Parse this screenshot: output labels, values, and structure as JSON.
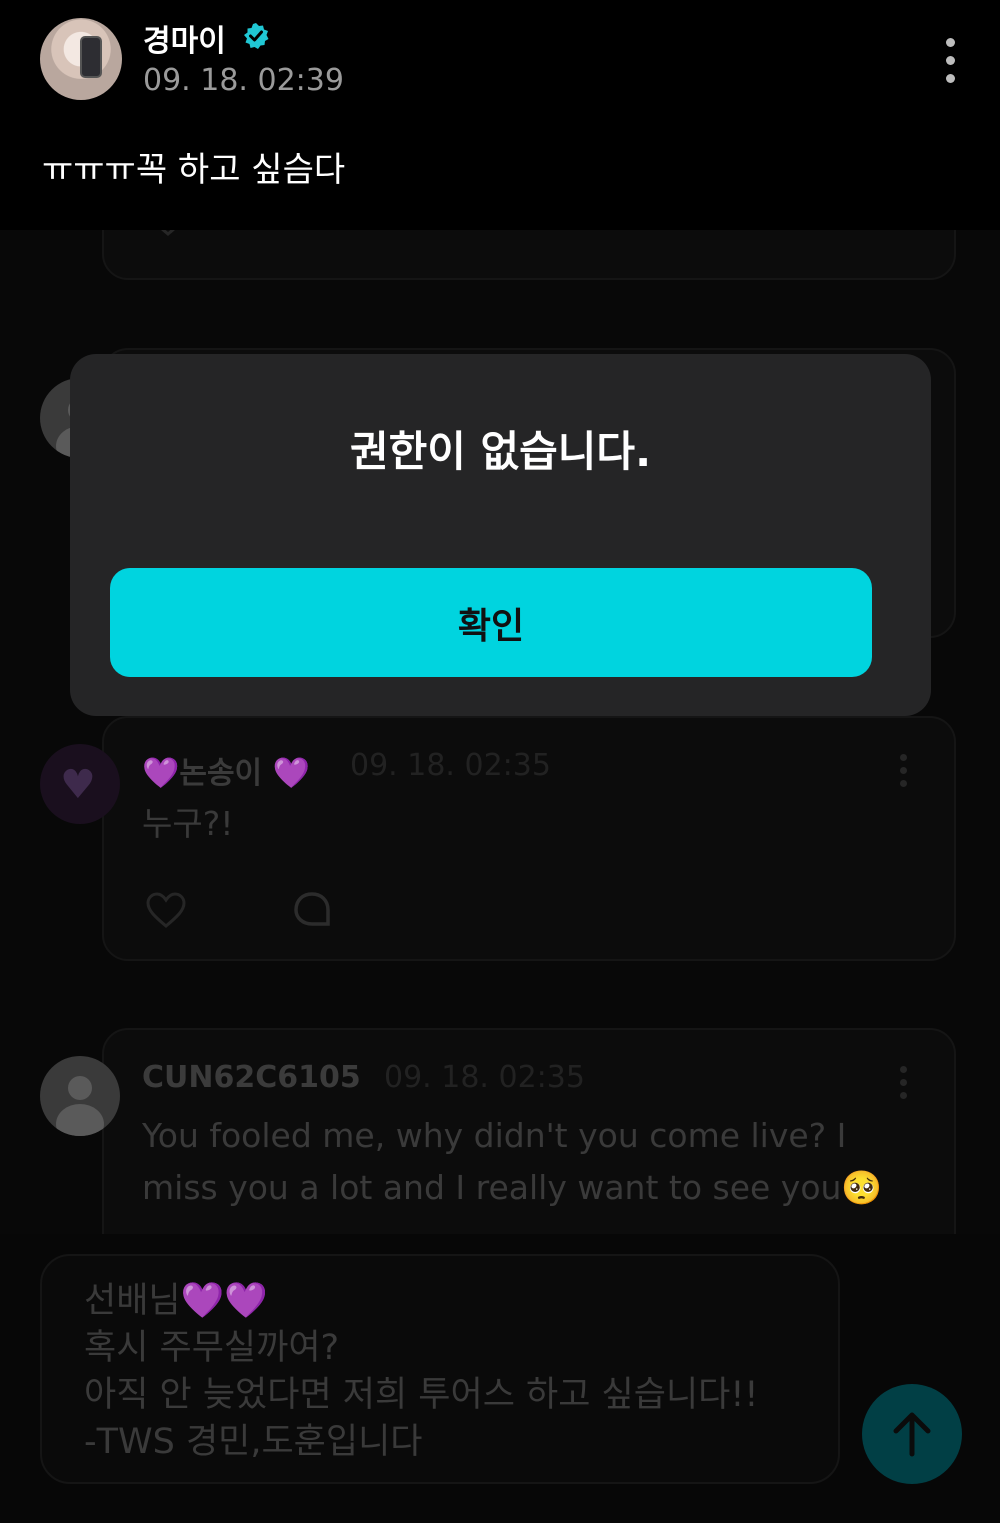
{
  "post": {
    "author": "경마이",
    "date": "09. 18. 02:39",
    "body": "ㅠㅠㅠ꼭 하고 싶슴다",
    "verified_icon": "verified-badge-icon",
    "more_icon": "vertical-dots-icon"
  },
  "comments": [
    {
      "name": "💜논송이 💜",
      "date": "09. 18. 02:35",
      "text": "누구?!"
    },
    {
      "name": "CUN62C6105",
      "date": "09. 18. 02:35",
      "text": "You fooled me, why didn't you come live? I miss you a lot and I really want to see you🥺"
    }
  ],
  "modal": {
    "title": "권한이 없습니다.",
    "confirm_label": "확인"
  },
  "composer": {
    "text": "선배님💜💜\n혹시 주무실까여?\n아직 안 늦었다면 저희 투어스 하고 싶습니다!!\n-TWS 경민,도훈입니다"
  },
  "colors": {
    "accent": "#00d4df",
    "verified": "#20c7d4",
    "modal_bg": "#252526"
  }
}
